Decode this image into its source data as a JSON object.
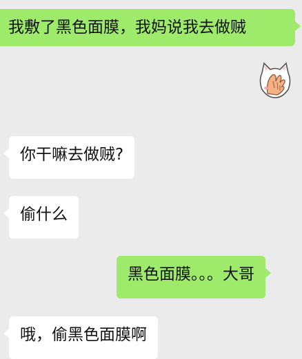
{
  "chat": {
    "messages": [
      {
        "sender": "me",
        "text": "我敷了黑色面膜，我妈说我去做贼"
      },
      {
        "sender": "me",
        "type": "sticker",
        "icon": "cat-face-palm-sticker"
      },
      {
        "sender": "other",
        "text": "你干嘛去做贼?"
      },
      {
        "sender": "other",
        "text": "偷什么"
      },
      {
        "sender": "me",
        "text": "黑色面膜。。。大哥"
      },
      {
        "sender": "other",
        "text": "哦，偷黑色面膜啊"
      }
    ]
  },
  "colors": {
    "background": "#ebebeb",
    "my_bubble": "#9eea6a",
    "other_bubble": "#ffffff",
    "text": "#111111"
  }
}
